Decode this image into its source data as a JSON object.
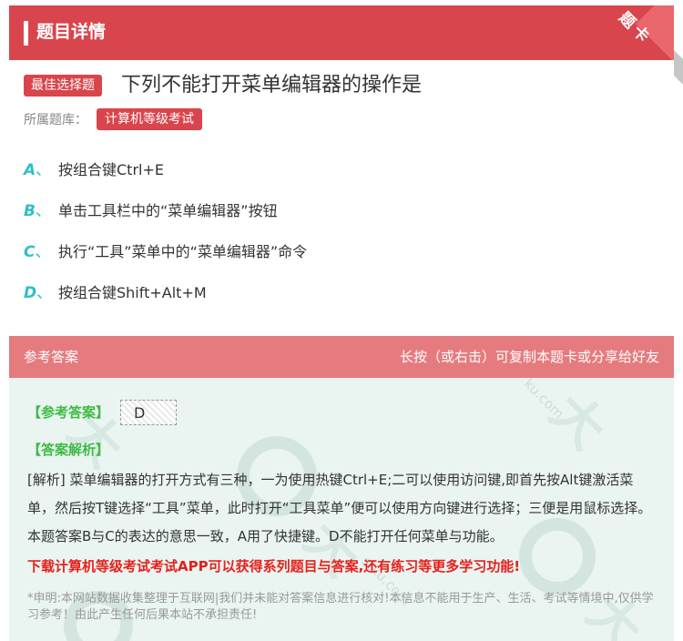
{
  "header": {
    "title": "题目详情",
    "corner_label": "题卡"
  },
  "question": {
    "type_badge": "最佳选择题",
    "title": "下列不能打开菜单编辑器的操作是",
    "bank_label": "所属题库：",
    "bank_name": "计算机等级考试"
  },
  "options": [
    {
      "letter": "A",
      "text": "按组合键Ctrl+E"
    },
    {
      "letter": "B",
      "text": "单击工具栏中的“菜单编辑器”按钮"
    },
    {
      "letter": "C",
      "text": "执行“工具”菜单中的“菜单编辑器”命令"
    },
    {
      "letter": "D",
      "text": "按组合键Shift+Alt+M"
    }
  ],
  "answer": {
    "header_left": "参考答案",
    "header_right": "长按（或右击）可复制本题卡或分享给好友",
    "answer_label": "【参考答案】",
    "answer_value": "D",
    "explanation_label": "【答案解析】",
    "explanation": "[解析] 菜单编辑器的打开方式有三种，一为使用热键Ctrl+E;二可以使用访问键,即首先按Alt键激活菜单，然后按T键选择“工具”菜单，此时打开“工具菜单”便可以使用方向键进行选择；三便是用鼠标选择。本题答案B与C的表达的意思一致，A用了快捷键。D不能打开任何菜单与功能。",
    "promo": "下载计算机等级考试考试APP可以获得系列题目与答案,还有练习等更多学习功能!",
    "disclaimer": "*申明:本网站数据收集整理于互联网|我们并未能对答案信息进行核对!本信息不能用于生产、生活、考试等情境中,仅供学习参考！由此产生任何后果本站不承担责任!"
  },
  "colors": {
    "brand_red": "#d9454c",
    "answer_header": "#e57b7f",
    "option_letter": "#2ebfc5",
    "answer_green": "#3dbb44",
    "promo_red": "#e8201b",
    "answer_bg": "#eaf4f1"
  }
}
